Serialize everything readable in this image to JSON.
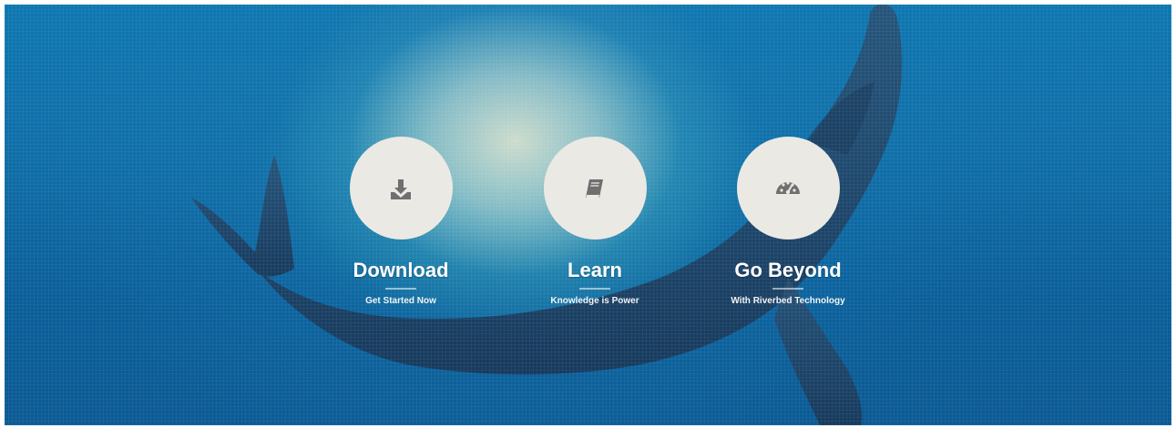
{
  "features": [
    {
      "title": "Download",
      "subtitle": "Get Started Now",
      "icon": "download-icon"
    },
    {
      "title": "Learn",
      "subtitle": "Knowledge is Power",
      "icon": "book-icon"
    },
    {
      "title": "Go Beyond",
      "subtitle": "With Riverbed Technology",
      "icon": "dashboard-icon"
    }
  ],
  "colors": {
    "circle_bg": "#ebe9e4",
    "icon": "#6f6f6f",
    "title": "#ffffff",
    "water": "#0e76b0",
    "shark": "#1b3f63"
  }
}
